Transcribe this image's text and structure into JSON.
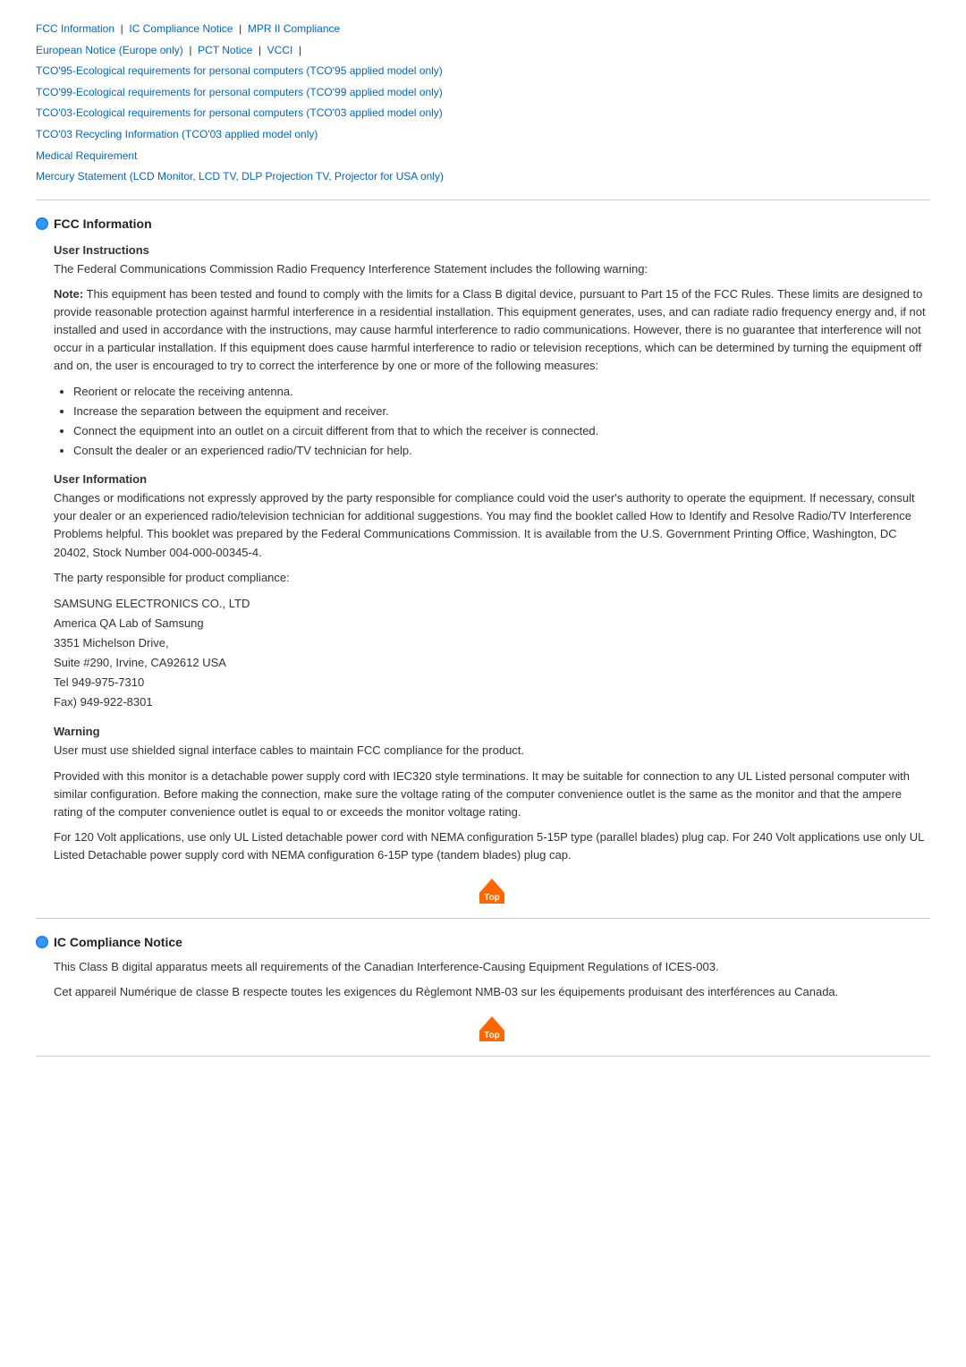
{
  "nav": {
    "links": [
      {
        "label": "FCC Information",
        "id": "fcc"
      },
      {
        "label": "IC Compliance Notice",
        "id": "ic"
      },
      {
        "label": "MPR II Compliance",
        "id": "mpr"
      },
      {
        "label": "European Notice (Europe only)",
        "id": "european"
      },
      {
        "label": "PCT Notice",
        "id": "pct"
      },
      {
        "label": "VCCI",
        "id": "vcci"
      },
      {
        "label": "TCO'95-Ecological requirements for personal computers (TCO'95 applied model only)",
        "id": "tco95"
      },
      {
        "label": "TCO'99-Ecological requirements for personal computers (TCO'99 applied model only)",
        "id": "tco99"
      },
      {
        "label": "TCO'03-Ecological requirements for personal computers (TCO'03 applied model only)",
        "id": "tco03"
      },
      {
        "label": "TCO'03 Recycling Information (TCO'03 applied model only)",
        "id": "tco03r"
      },
      {
        "label": "Medical Requirement",
        "id": "medical"
      },
      {
        "label": "Mercury Statement (LCD Monitor, LCD TV, DLP Projection TV, Projector for USA only)",
        "id": "mercury"
      }
    ]
  },
  "fcc_section": {
    "title": "FCC Information",
    "user_instructions": {
      "heading": "User Instructions",
      "intro": "The Federal Communications Commission Radio Frequency Interference Statement includes the following warning:",
      "note_prefix": "Note:",
      "note_body": " This equipment has been tested and found to comply with the limits for a Class B digital device, pursuant to Part 15 of the FCC Rules. These limits are designed to provide reasonable protection against harmful interference in a residential installation. This equipment generates, uses, and can radiate radio frequency energy and, if not installed and used in accordance with the instructions, may cause harmful interference to radio communications. However, there is no guarantee that interference will not occur in a particular installation. If this equipment does cause harmful interference to radio or television receptions, which can be determined by turning the equipment off and on, the user is encouraged to try to correct the interference by one or more of the following measures:",
      "bullets": [
        "Reorient or relocate the receiving antenna.",
        "Increase the separation between the equipment and receiver.",
        "Connect the equipment into an outlet on a circuit different from that to which the receiver is connected.",
        "Consult the dealer or an experienced radio/TV technician for help."
      ]
    },
    "user_information": {
      "heading": "User Information",
      "paragraph1": "Changes or modifications not expressly approved by the party responsible for compliance could void the user's authority to operate the equipment. If necessary, consult your dealer or an experienced radio/television technician for additional suggestions. You may find the booklet called How to Identify and Resolve Radio/TV Interference Problems helpful. This booklet was prepared by the Federal Communications Commission. It is available from the U.S. Government Printing Office, Washington, DC 20402, Stock Number 004-000-00345-4.",
      "paragraph2": "The party responsible for product compliance:",
      "company_block": "SAMSUNG ELECTRONICS CO., LTD\nAmerica QA Lab of Samsung\n3351 Michelson Drive,\nSuite #290, Irvine, CA92612 USA\nTel 949-975-7310\nFax) 949-922-8301"
    },
    "warning": {
      "heading": "Warning",
      "paragraph1": "User must use shielded signal interface cables to maintain FCC compliance for the product.",
      "paragraph2": "Provided with this monitor is a detachable power supply cord with IEC320 style terminations. It may be suitable for connection to any UL Listed personal computer with similar configuration. Before making the connection, make sure the voltage rating of the computer convenience outlet is the same as the monitor and that the ampere rating of the computer convenience outlet is equal to or exceeds the monitor voltage rating.",
      "paragraph3": "For 120 Volt applications, use only UL Listed detachable power cord with NEMA configuration 5-15P type (parallel blades) plug cap. For 240 Volt applications use only UL Listed Detachable power supply cord with NEMA configuration 6-15P type (tandem blades) plug cap."
    }
  },
  "ic_section": {
    "title": "IC Compliance Notice",
    "paragraph1": "This Class B digital apparatus meets all requirements of the Canadian Interference-Causing Equipment Regulations of ICES-003.",
    "paragraph2": "Cet appareil Numérique de classe B respecte toutes les exigences du Règlemont NMB-03 sur les équipements produisant des interférences au Canada."
  },
  "top_button_label": "Top"
}
